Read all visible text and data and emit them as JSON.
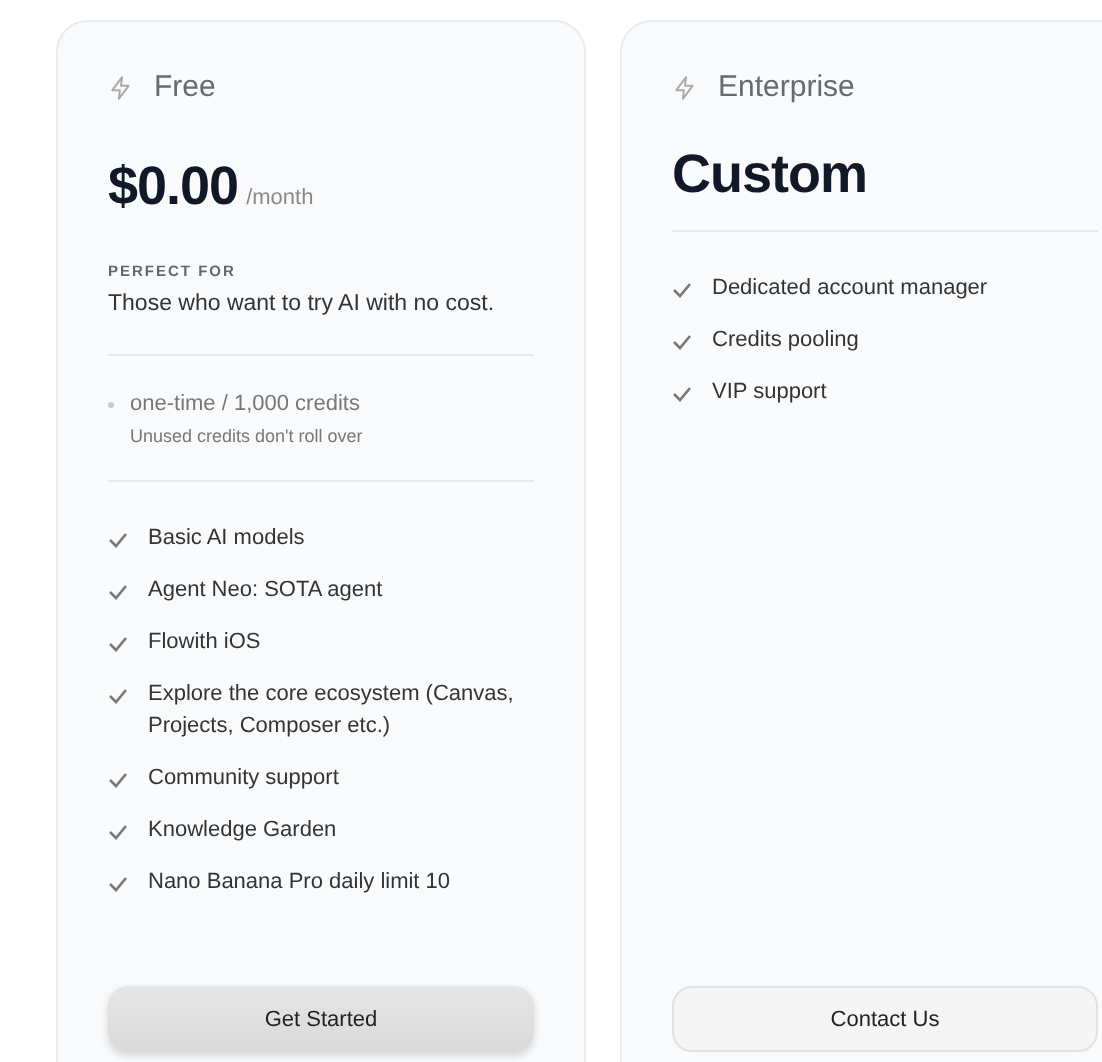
{
  "plans": [
    {
      "kind": "priced",
      "name": "Free",
      "price": "$0.00",
      "period": "/month",
      "audience_label": "PERFECT FOR",
      "audience": "Those who want to try AI with no cost.",
      "credits": "one-time / 1,000 credits",
      "credits_note": "Unused credits don't roll over",
      "features": [
        "Basic AI models",
        "Agent Neo: SOTA agent",
        "Flowith iOS",
        "Explore the core ecosystem (Canvas, Projects, Composer etc.)",
        "Community support",
        "Knowledge Garden",
        "Nano Banana Pro daily limit 10"
      ],
      "button": "Get Started",
      "button_primary": true
    },
    {
      "kind": "custom",
      "name": "Enterprise",
      "price": "Custom",
      "features": [
        "Dedicated account manager",
        "Credits pooling",
        "VIP support"
      ],
      "button": "Contact Us",
      "button_primary": false
    }
  ]
}
